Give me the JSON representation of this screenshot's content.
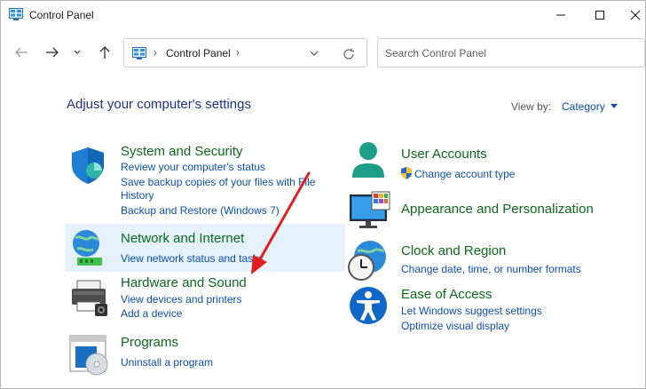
{
  "window": {
    "title": "Control Panel",
    "icon": "control-panel-icon"
  },
  "address": {
    "crumb": "Control Panel",
    "separator": "›"
  },
  "search": {
    "placeholder": "Search Control Panel"
  },
  "main": {
    "heading": "Adjust your computer's settings",
    "view_by_label": "View by:",
    "view_by_value": "Category"
  },
  "categories": {
    "system": {
      "title": "System and Security",
      "icon": "shield-icon",
      "links": [
        "Review your computer's status",
        "Save backup copies of your files with File History",
        "Backup and Restore (Windows 7)"
      ]
    },
    "network": {
      "title": "Network and Internet",
      "icon": "network-globe-icon",
      "links": [
        "View network status and tasks"
      ]
    },
    "hardware": {
      "title": "Hardware and Sound",
      "icon": "printer-icon",
      "links": [
        "View devices and printers",
        "Add a device"
      ]
    },
    "programs": {
      "title": "Programs",
      "icon": "programs-disc-icon",
      "links": [
        "Uninstall a program"
      ]
    },
    "users": {
      "title": "User Accounts",
      "icon": "user-icon",
      "links": [
        "Change account type"
      ]
    },
    "appearance": {
      "title": "Appearance and Personalization",
      "icon": "monitor-icon",
      "links": []
    },
    "clock": {
      "title": "Clock and Region",
      "icon": "clock-globe-icon",
      "links": [
        "Change date, time, or number formats"
      ]
    },
    "access": {
      "title": "Ease of Access",
      "icon": "accessibility-icon",
      "links": [
        "Let Windows suggest settings",
        "Optimize visual display"
      ]
    }
  },
  "colors": {
    "category_title": "#0b6a1b",
    "link": "#0b4fb3",
    "heading": "#1e3287",
    "highlight": "#e5f1fb",
    "annotation_arrow": "#e0201e"
  }
}
